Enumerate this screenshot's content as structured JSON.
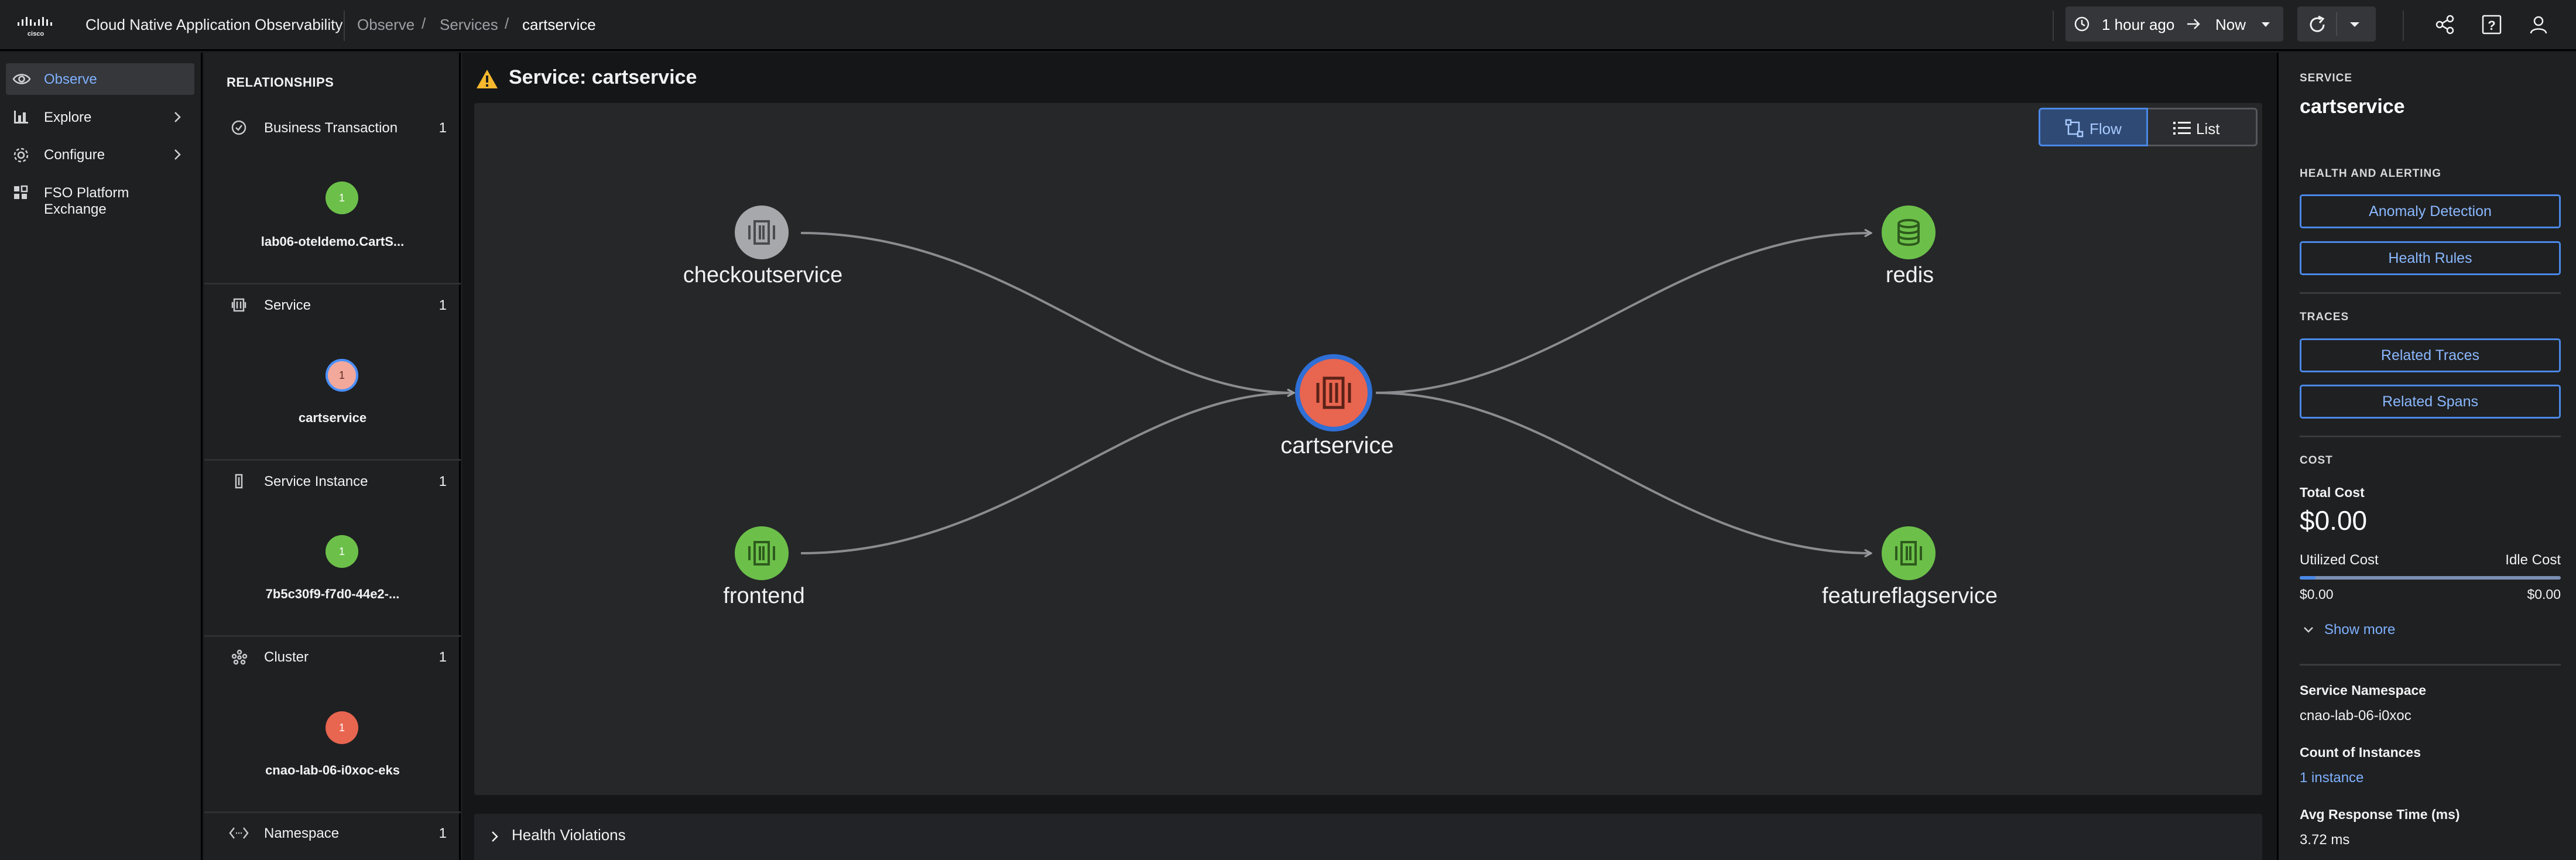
{
  "app": {
    "title": "Cloud Native Application Observability",
    "logo_text": "cisco"
  },
  "breadcrumb": [
    "Observe",
    "Services",
    "cartservice"
  ],
  "time_range": {
    "from": "1 hour ago",
    "to": "Now"
  },
  "nav": {
    "items": [
      {
        "label": "Observe",
        "icon": "eye-icon",
        "active": true,
        "chevron": false
      },
      {
        "label": "Explore",
        "icon": "bar-chart-icon",
        "active": false,
        "chevron": true
      },
      {
        "label": "Configure",
        "icon": "gear-icon",
        "active": false,
        "chevron": true
      },
      {
        "label": "FSO Platform Exchange",
        "icon": "grid-icon",
        "active": false,
        "chevron": false
      }
    ]
  },
  "relationships": {
    "title": "RELATIONSHIPS",
    "groups": [
      {
        "name": "Business Transaction",
        "count": "1",
        "node_count": "1",
        "node_status": "healthy",
        "entity": "lab06-oteldemo.CartS..."
      },
      {
        "name": "Service",
        "count": "1",
        "node_count": "1",
        "node_status": "selected",
        "entity": "cartservice"
      },
      {
        "name": "Service Instance",
        "count": "1",
        "node_count": "1",
        "node_status": "healthy",
        "entity": "7b5c30f9-f7d0-44e2-..."
      },
      {
        "name": "Cluster",
        "count": "1",
        "node_count": "1",
        "node_status": "critical",
        "entity": "cnao-lab-06-i0xoc-eks"
      },
      {
        "name": "Namespace",
        "count": "1"
      }
    ]
  },
  "main": {
    "title": "Service: cartservice",
    "view_toggle": {
      "flow": "Flow",
      "list": "List",
      "selected": "flow"
    },
    "graph": {
      "nodes": [
        {
          "id": "checkoutservice",
          "label": "checkoutservice",
          "status": "unknown",
          "icon": "service-icon"
        },
        {
          "id": "frontend",
          "label": "frontend",
          "status": "healthy",
          "icon": "service-icon"
        },
        {
          "id": "cartservice",
          "label": "cartservice",
          "status": "critical",
          "icon": "service-icon",
          "focused": true
        },
        {
          "id": "redis",
          "label": "redis",
          "status": "healthy",
          "icon": "database-icon"
        },
        {
          "id": "featureflagservice",
          "label": "featureflagservice",
          "status": "healthy",
          "icon": "service-icon"
        }
      ],
      "edges": [
        {
          "from": "checkoutservice",
          "to": "cartservice"
        },
        {
          "from": "frontend",
          "to": "cartservice"
        },
        {
          "from": "cartservice",
          "to": "redis"
        },
        {
          "from": "cartservice",
          "to": "featureflagservice"
        }
      ]
    },
    "health_violations": "Health Violations"
  },
  "details": {
    "caption": "SERVICE",
    "name": "cartservice",
    "health_caption": "HEALTH AND ALERTING",
    "anomaly_btn": "Anomaly Detection",
    "health_rules_btn": "Health Rules",
    "traces_caption": "TRACES",
    "related_traces_btn": "Related Traces",
    "related_spans_btn": "Related Spans",
    "cost_caption": "COST",
    "total_cost_label": "Total Cost",
    "total_cost": "$0.00",
    "utilized_label": "Utilized Cost",
    "idle_label": "Idle Cost",
    "utilized_value": "$0.00",
    "idle_value": "$0.00",
    "utilized_fraction": 0.06,
    "show_more": "Show more",
    "namespace_label": "Service Namespace",
    "namespace_value": "cnao-lab-06-i0xoc",
    "instances_label": "Count of Instances",
    "instances_value": "1 instance",
    "response_label": "Avg Response Time (ms)",
    "response_value": "3.72 ms"
  },
  "colors": {
    "accent": "#4a88e6",
    "healthy": "#6cc04a",
    "critical": "#e8654f",
    "unknown": "#a6a8ab",
    "warning": "#f5b82e"
  }
}
